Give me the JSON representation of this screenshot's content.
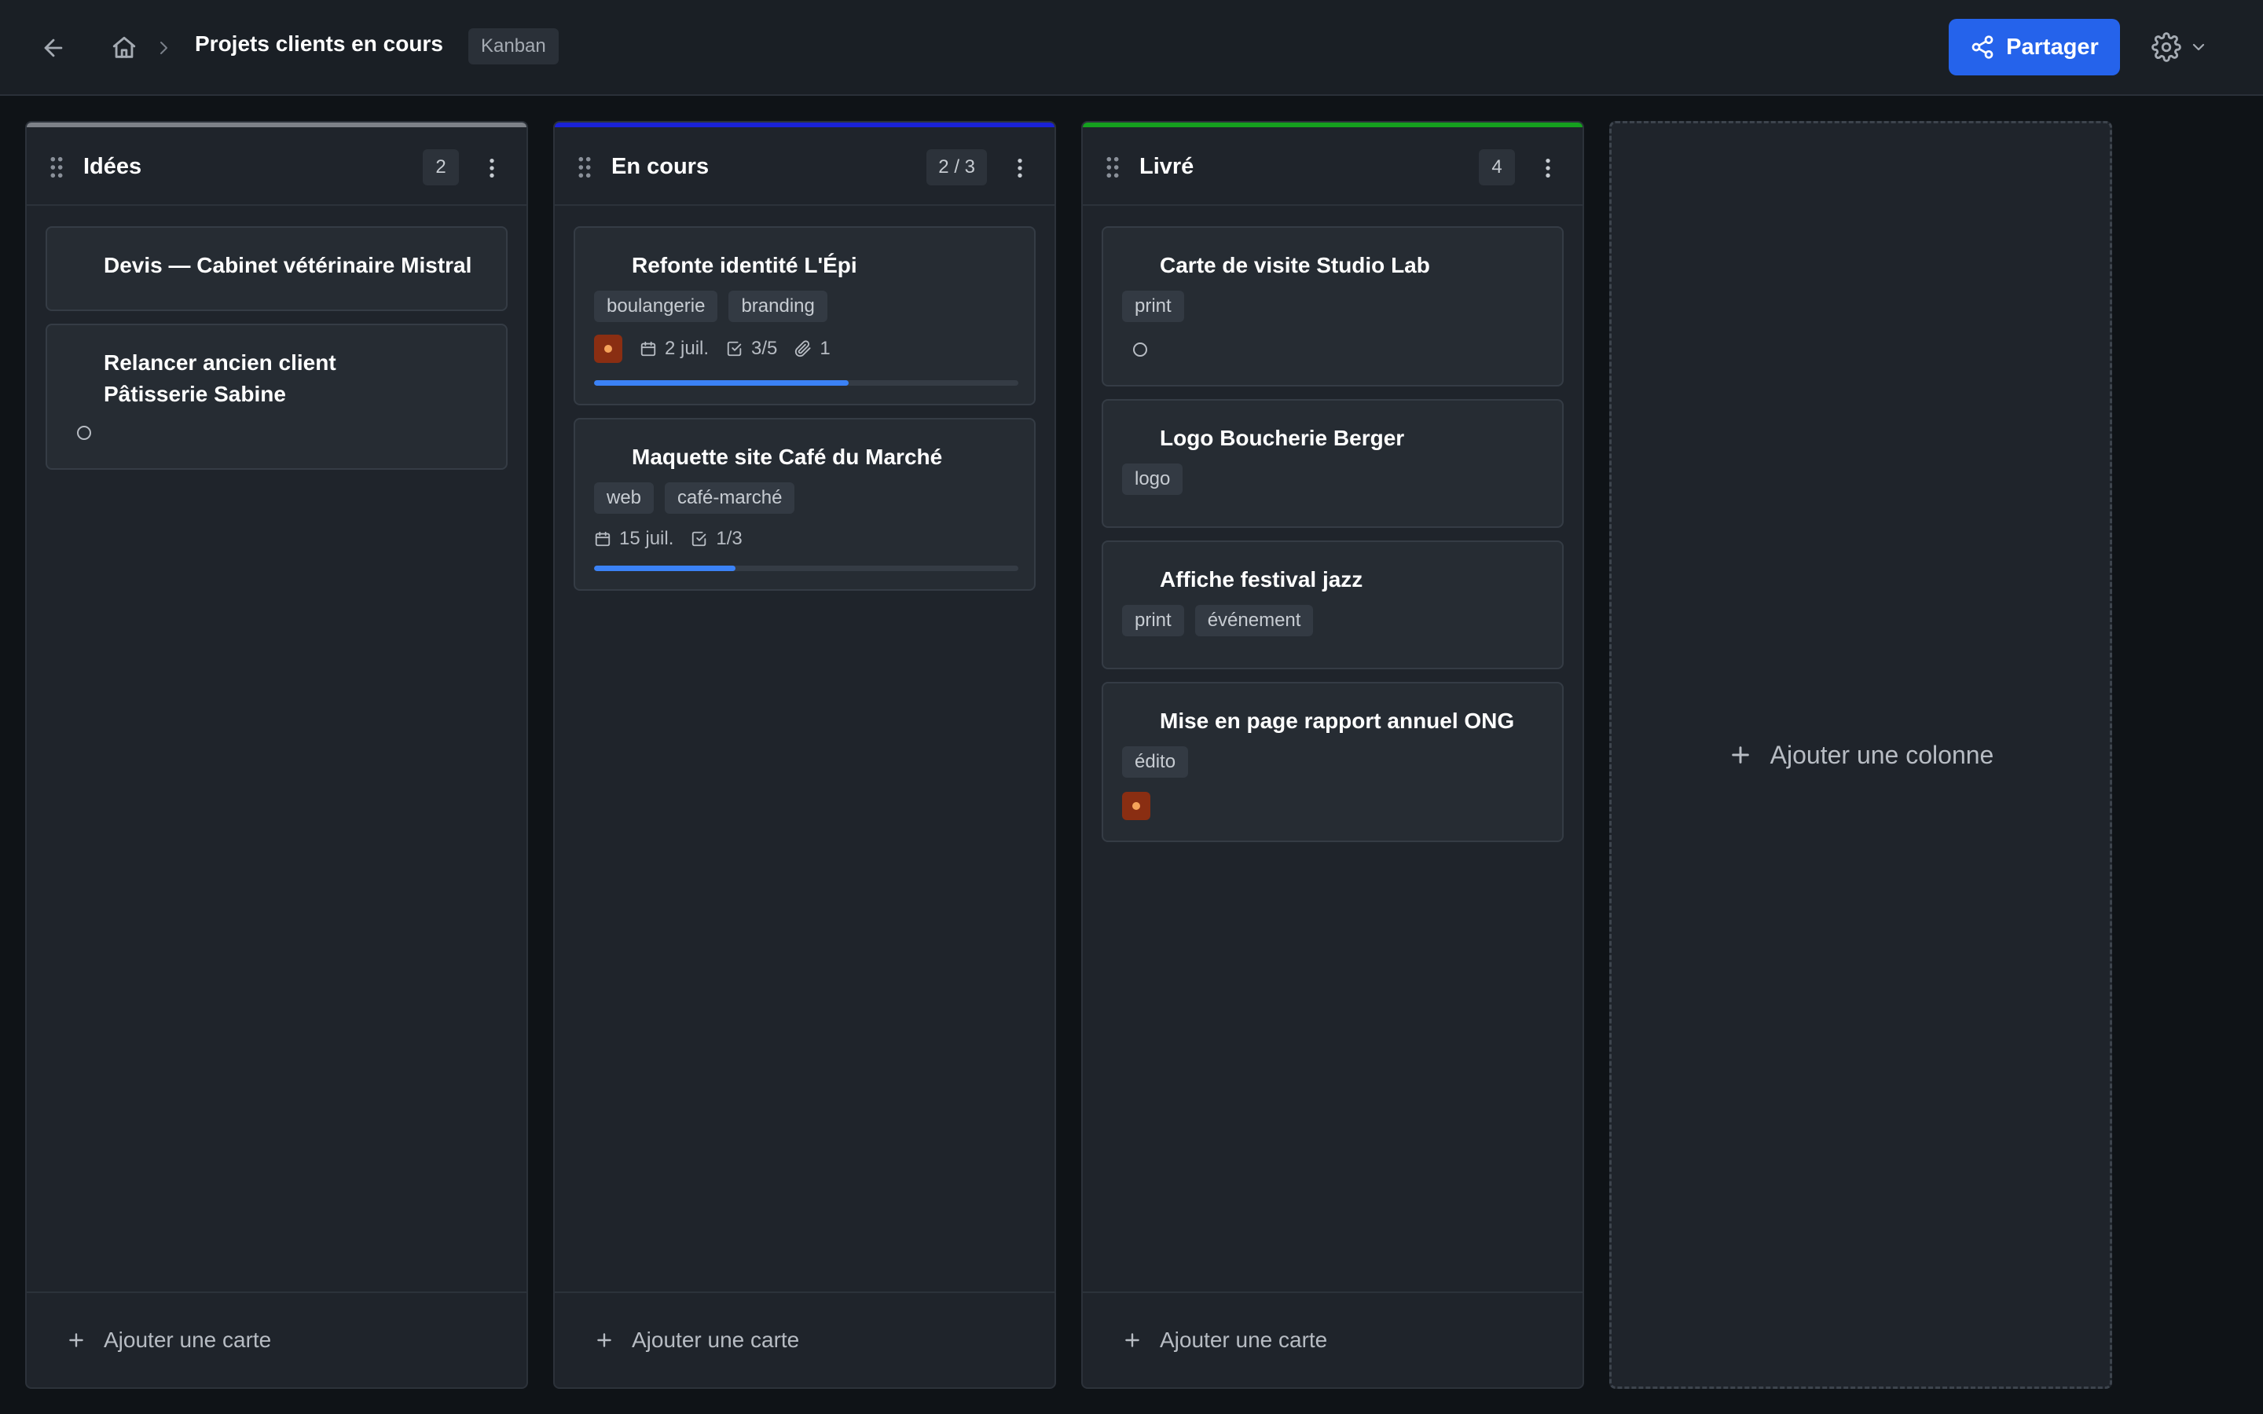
{
  "header": {
    "title": "Projets clients en cours",
    "view_badge": "Kanban",
    "share_label": "Partager",
    "icons": [
      "back-arrow-icon",
      "home-icon",
      "chevron-right-icon",
      "share-icon",
      "gear-icon",
      "chevron-down-icon"
    ]
  },
  "columns": [
    {
      "title": "Idées",
      "count": "2",
      "accent": "#7d8188",
      "add_card_label": "Ajouter une carte",
      "cards": [
        {
          "title": "Devis — Cabinet vétérinaire Mistral"
        },
        {
          "title": "Relancer ancien client Pâtisserie Sabine"
        }
      ]
    },
    {
      "title": "En cours",
      "count": "2 / 3",
      "accent": "#1a22d6",
      "add_card_label": "Ajouter une carte",
      "cards": [
        {
          "title": "Refonte identité L'Épi",
          "tags": [
            "boulangerie",
            "branding"
          ],
          "date": "2 juil.",
          "checklist": "3/5",
          "attachments": "1",
          "progress": 0.6
        },
        {
          "title": "Maquette site Café du Marché",
          "tags": [
            "web",
            "café-marché"
          ],
          "date": "15 juil.",
          "checklist": "1/3",
          "progress": 0.333
        }
      ]
    },
    {
      "title": "Livré",
      "count": "4",
      "accent": "#15a01f",
      "add_card_label": "Ajouter une carte",
      "cards": [
        {
          "title": "Carte de visite Studio Lab",
          "tags": [
            "print"
          ]
        },
        {
          "title": "Logo Boucherie Berger",
          "tags": [
            "logo"
          ]
        },
        {
          "title": "Affiche festival jazz",
          "tags": [
            "print",
            "événement"
          ]
        },
        {
          "title": "Mise en page rapport annuel ONG",
          "tags": [
            "édito"
          ]
        }
      ]
    }
  ],
  "add_column_label": "Ajouter une colonne",
  "colors": {
    "primary": "#2563eb",
    "progress": "#3b82f6",
    "avatar": "#8a2e12"
  }
}
